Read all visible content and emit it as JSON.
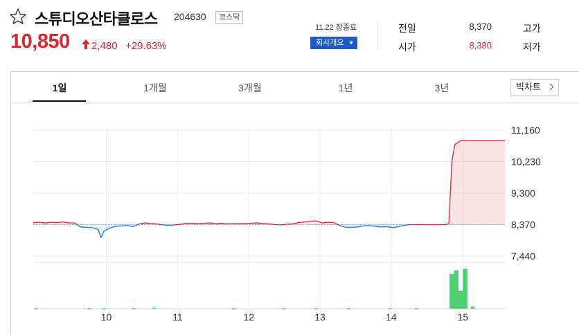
{
  "stock": {
    "name": "스튜디오산타클로스",
    "code": "204630",
    "market": "코스닥",
    "price": "10,850",
    "change": "2,480",
    "rate": "+29.63%"
  },
  "status": {
    "closed_time": "11.22 장종료",
    "company_button": "회사개요"
  },
  "stats": [
    {
      "label": "전일",
      "value": "8,370",
      "color": "#222222"
    },
    {
      "label": "고가",
      "value": "",
      "color": "#e0242f"
    },
    {
      "label": "시가",
      "value": "8,380",
      "color": "#e0242f"
    },
    {
      "label": "저가",
      "value": "",
      "color": "#1f5bc6"
    }
  ],
  "tabs": [
    "1일",
    "1개월",
    "3개월",
    "1년",
    "3년"
  ],
  "active_tab": "1일",
  "big_chart_label": "빅차트",
  "colors": {
    "up": "#e0242f",
    "down": "#1f78d1",
    "volume": "#4fcf6f"
  },
  "chart_data": {
    "type": "line",
    "y_ticks": [
      "11,160",
      "10,230",
      "9,300",
      "8,370",
      "7,440"
    ],
    "x_ticks": [
      "10",
      "11",
      "12",
      "13",
      "14",
      "15"
    ],
    "baseline": 8370,
    "ylim": [
      7440,
      11160
    ],
    "price_points": [
      [
        0,
        8430
      ],
      [
        2,
        8440
      ],
      [
        4,
        8420
      ],
      [
        6,
        8440
      ],
      [
        8,
        8430
      ],
      [
        10,
        8450
      ],
      [
        12,
        8420
      ],
      [
        14,
        8420
      ],
      [
        16,
        8300
      ],
      [
        18,
        8290
      ],
      [
        20,
        8280
      ],
      [
        22,
        8230
      ],
      [
        23,
        7980
      ],
      [
        24,
        8180
      ],
      [
        26,
        8270
      ],
      [
        28,
        8320
      ],
      [
        30,
        8330
      ],
      [
        32,
        8340
      ],
      [
        34,
        8310
      ],
      [
        36,
        8390
      ],
      [
        38,
        8420
      ],
      [
        40,
        8400
      ],
      [
        42,
        8390
      ],
      [
        44,
        8360
      ],
      [
        46,
        8350
      ],
      [
        48,
        8360
      ],
      [
        50,
        8380
      ],
      [
        52,
        8410
      ],
      [
        54,
        8410
      ],
      [
        56,
        8400
      ],
      [
        58,
        8410
      ],
      [
        60,
        8420
      ],
      [
        62,
        8400
      ],
      [
        64,
        8410
      ],
      [
        66,
        8390
      ],
      [
        68,
        8400
      ],
      [
        70,
        8400
      ],
      [
        72,
        8400
      ],
      [
        74,
        8410
      ],
      [
        76,
        8420
      ],
      [
        78,
        8400
      ],
      [
        80,
        8390
      ],
      [
        82,
        8370
      ],
      [
        84,
        8360
      ],
      [
        86,
        8380
      ],
      [
        88,
        8390
      ],
      [
        90,
        8430
      ],
      [
        92,
        8450
      ],
      [
        94,
        8470
      ],
      [
        96,
        8480
      ],
      [
        98,
        8420
      ],
      [
        100,
        8440
      ],
      [
        102,
        8430
      ],
      [
        104,
        8340
      ],
      [
        106,
        8290
      ],
      [
        108,
        8290
      ],
      [
        110,
        8300
      ],
      [
        112,
        8330
      ],
      [
        114,
        8340
      ],
      [
        116,
        8320
      ],
      [
        118,
        8300
      ],
      [
        120,
        8310
      ],
      [
        122,
        8280
      ],
      [
        124,
        8310
      ],
      [
        126,
        8350
      ],
      [
        128,
        8370
      ],
      [
        130,
        8370
      ],
      [
        132,
        8370
      ],
      [
        134,
        8370
      ],
      [
        136,
        8370
      ],
      [
        138,
        8370
      ],
      [
        140,
        8370
      ],
      [
        141,
        8400
      ],
      [
        142,
        10230
      ],
      [
        143,
        10730
      ],
      [
        145,
        10850
      ],
      [
        150,
        10850
      ],
      [
        155,
        10850
      ],
      [
        160,
        10850
      ]
    ],
    "volume_points": [
      [
        1,
        1
      ],
      [
        19,
        1
      ],
      [
        24,
        1
      ],
      [
        34,
        1
      ],
      [
        41,
        2
      ],
      [
        68,
        1
      ],
      [
        85,
        1
      ],
      [
        96,
        1
      ],
      [
        107,
        1
      ],
      [
        121,
        1
      ],
      [
        130,
        1
      ],
      [
        142,
        75
      ],
      [
        143.5,
        83
      ],
      [
        145,
        39
      ],
      [
        146.5,
        86
      ],
      [
        149,
        5
      ]
    ],
    "volume_max": 100,
    "x_count": 160
  }
}
